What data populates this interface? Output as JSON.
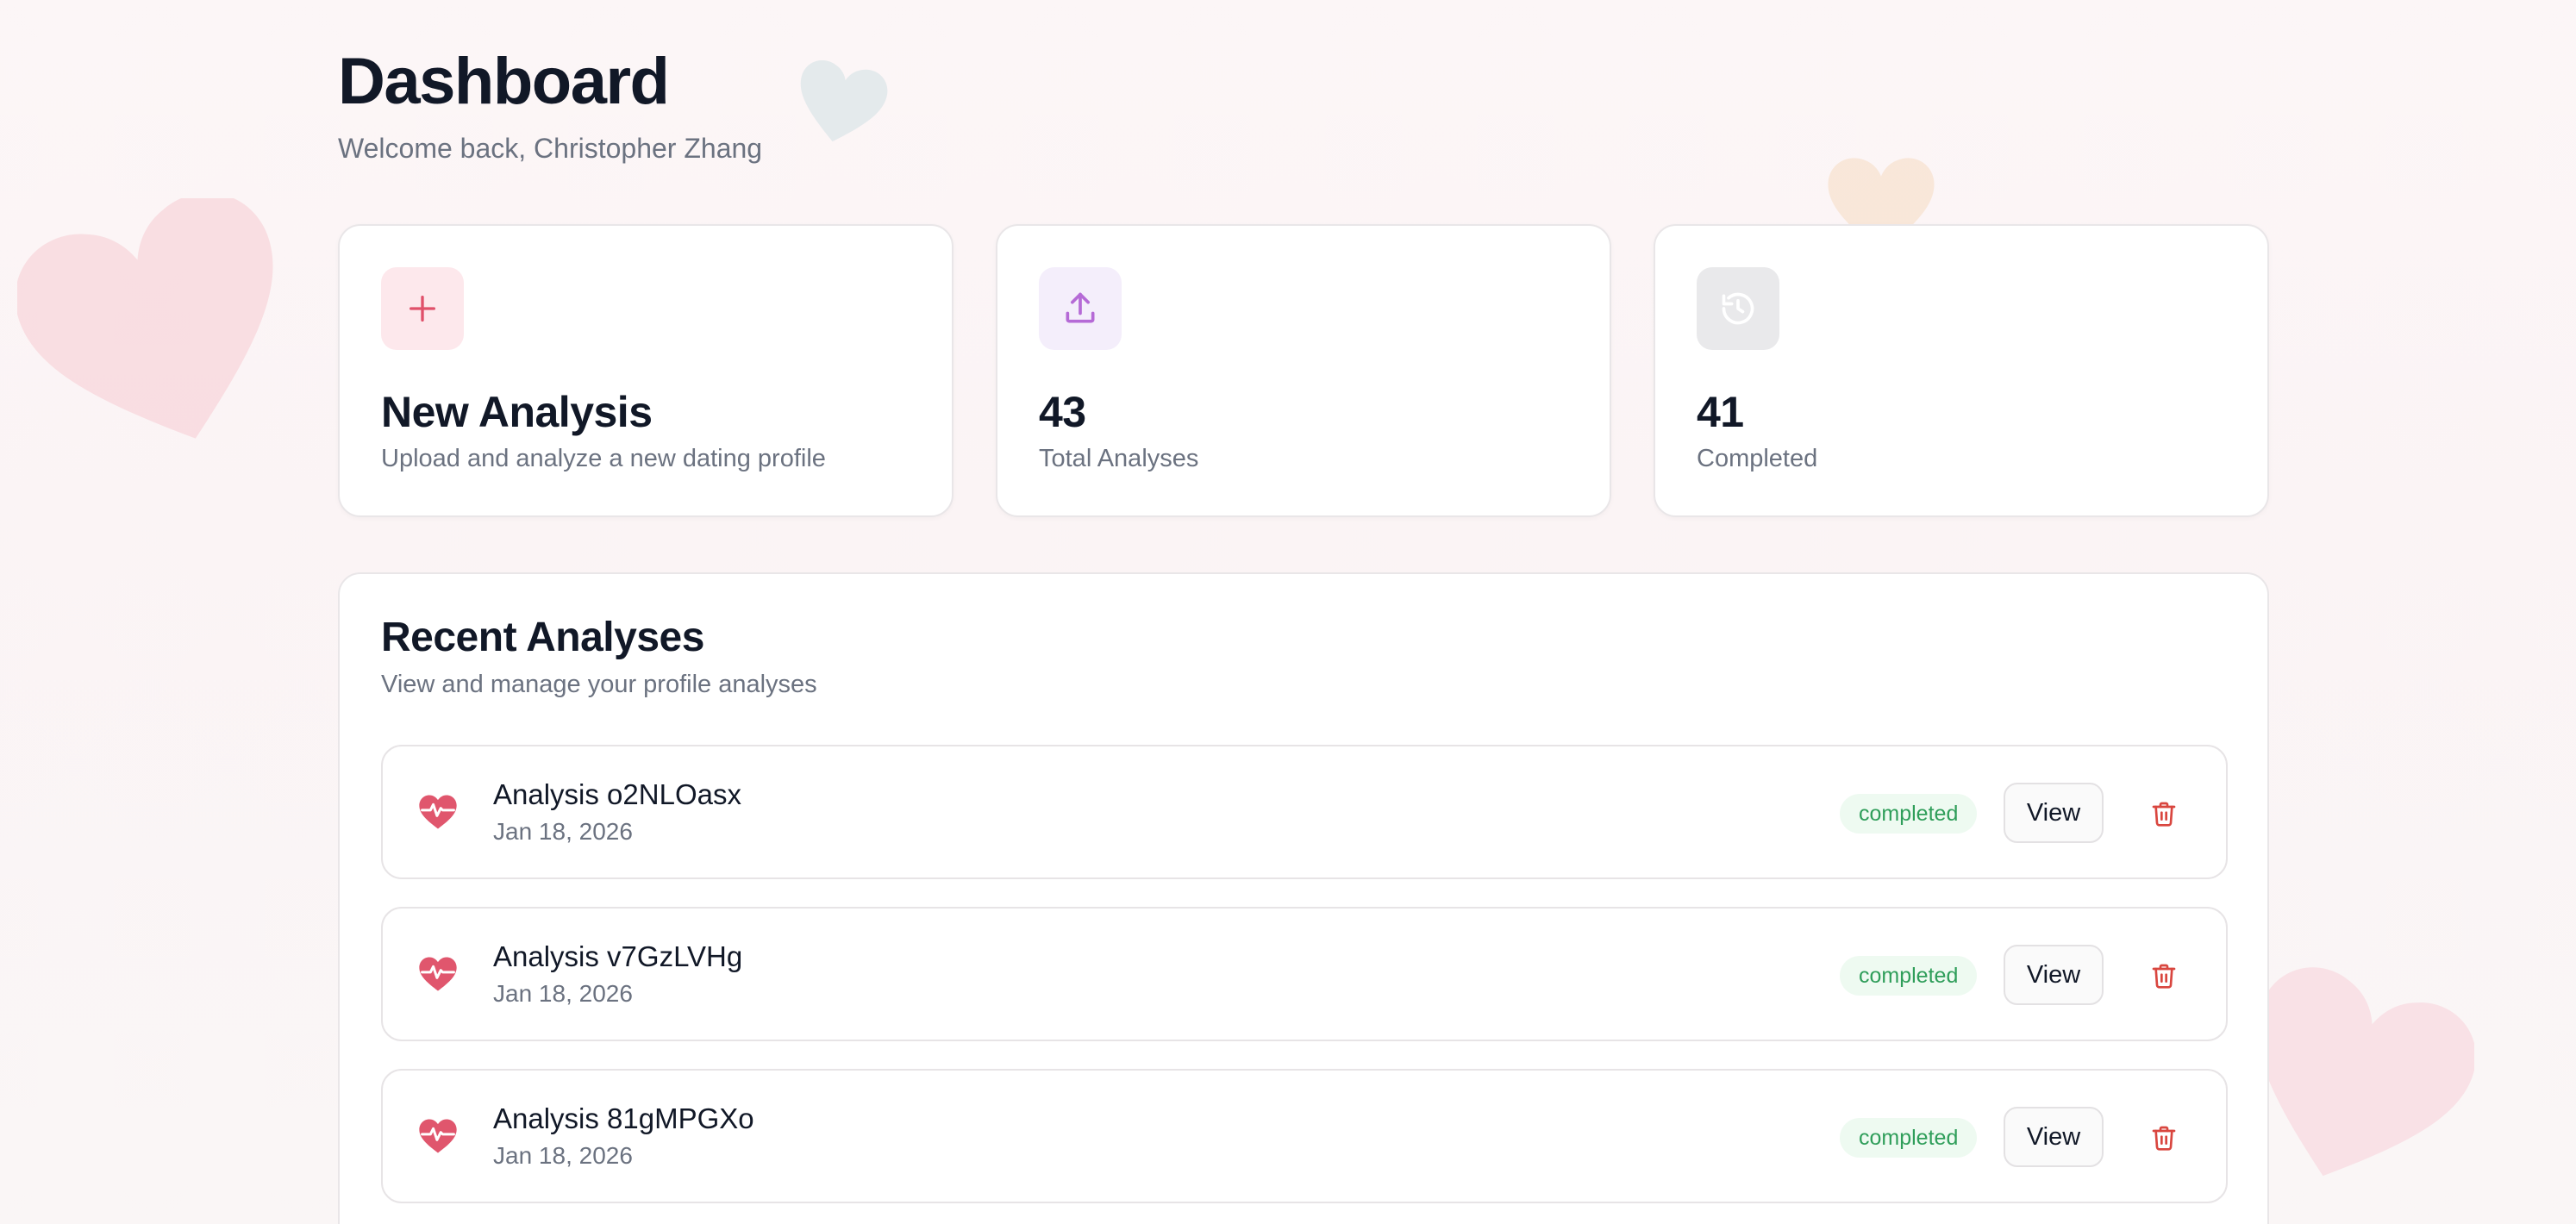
{
  "header": {
    "title": "Dashboard",
    "subtitle": "Welcome back, Christopher Zhang"
  },
  "stats": [
    {
      "icon": "plus-icon",
      "value": "New Analysis",
      "label": "Upload and analyze a new dating profile",
      "icon_bg": "#fde8ec",
      "icon_color": "#e0506a"
    },
    {
      "icon": "upload-icon",
      "value": "43",
      "label": "Total Analyses",
      "icon_bg": "#f4eefb",
      "icon_color": "#b56ad6"
    },
    {
      "icon": "history-icon",
      "value": "41",
      "label": "Completed",
      "icon_bg": "#e9e9eb",
      "icon_color": "#ffffff"
    }
  ],
  "recent": {
    "title": "Recent Analyses",
    "subtitle": "View and manage your profile analyses",
    "view_label": "View",
    "items": [
      {
        "title": "Analysis o2NLOasx",
        "date": "Jan 18, 2026",
        "status": "completed"
      },
      {
        "title": "Analysis v7GzLVHg",
        "date": "Jan 18, 2026",
        "status": "completed"
      },
      {
        "title": "Analysis 81gMPGXo",
        "date": "Jan 18, 2026",
        "status": "completed"
      }
    ]
  },
  "colors": {
    "accent": "#e0506a",
    "status_green": "#2f9e5a",
    "status_green_bg": "#eefaf1",
    "delete_red": "#d9463f"
  },
  "icons": {
    "row": "heart-pulse-icon",
    "delete": "trash-icon"
  }
}
